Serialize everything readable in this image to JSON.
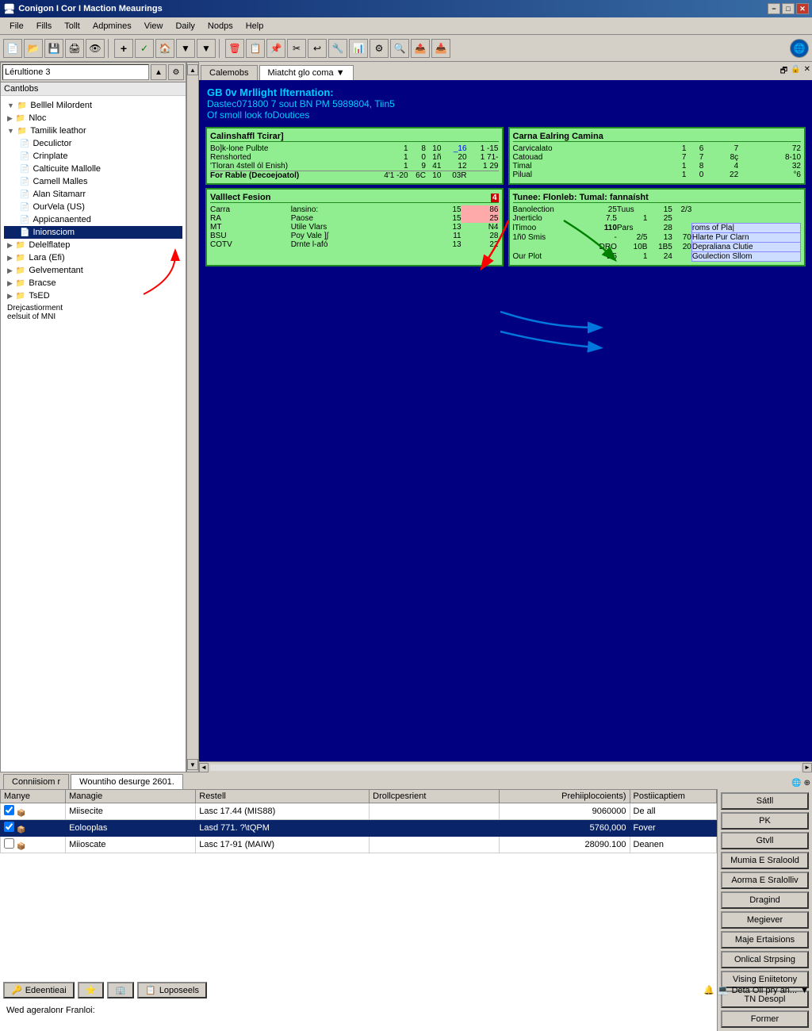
{
  "titlebar": {
    "title": "Conigon I Cor I Maction Meaurings",
    "min_btn": "−",
    "max_btn": "□",
    "close_btn": "✕"
  },
  "menubar": {
    "items": [
      "File",
      "Fills",
      "Tollt",
      "Adpmines",
      "View",
      "Daily",
      "Nodps",
      "Help"
    ]
  },
  "dropdown": {
    "value": "Lérultione 3"
  },
  "tabs": {
    "items": [
      "Calemobs",
      "Miatcht glo coma"
    ]
  },
  "left_panel": {
    "header": "Cantlobs",
    "tree": [
      {
        "label": "Belllel Milordent",
        "level": 1,
        "expanded": true
      },
      {
        "label": "Nloc",
        "level": 1
      },
      {
        "label": "Tamilik leathor",
        "level": 1,
        "expanded": true
      },
      {
        "label": "Deculictor",
        "level": 2
      },
      {
        "label": "Crinplate",
        "level": 2
      },
      {
        "label": "Calticuite Mallolle",
        "level": 2
      },
      {
        "label": "Camell Malles",
        "level": 2
      },
      {
        "label": "Alan Sitamarr",
        "level": 2
      },
      {
        "label": "OurVela (US)",
        "level": 2
      },
      {
        "label": "Appicanaented",
        "level": 2
      },
      {
        "label": "Inionsciom",
        "level": 2,
        "selected": true
      },
      {
        "label": "Delelflatep",
        "level": 1
      },
      {
        "label": "Lara (Efi)",
        "level": 1
      },
      {
        "label": "Gelvementant",
        "level": 1
      },
      {
        "label": "Bracse",
        "level": 1
      },
      {
        "label": "TsED",
        "level": 1
      }
    ]
  },
  "content": {
    "info_line1": "GB 0v Mrllight lfternation:",
    "info_line2": "Dastec071800 7 sout BN PM 5989804, Tiin5",
    "info_line3": "Of smoll look foDoutices"
  },
  "carinshaffl_panel": {
    "title": "Calinshaffl Tcirar]",
    "rows": [
      {
        "label": "Bo]k-lone Pulbte",
        "c1": 1,
        "c2": 8,
        "c3": 10,
        "c4": -16,
        "c5": "1 -15"
      },
      {
        "label": "Renshorted",
        "c1": 1,
        "c2": 0,
        "c3": "1(1",
        "c4": 20,
        "c5": "1 71"
      },
      {
        "label": "'Tloran 4stell ól Enish)",
        "c1": 1,
        "c2": 9,
        "c3": 41,
        "c4": 12,
        "c5": "1 29"
      },
      {
        "label": "For Rable (Decoejoatol)",
        "c1": "4'1 -20",
        "c2": "6C",
        "c3": 10,
        "c4": "03R",
        "c5": ""
      }
    ]
  },
  "carna_panel": {
    "title": "Carna Ealring Camina",
    "rows": [
      {
        "label": "Carvicalato",
        "c1": 1,
        "c2": 6,
        "c3": 7,
        "c4": 72
      },
      {
        "label": "Catouad",
        "c1": "7",
        "c2": 7,
        "c3": "87",
        "c4": "8-10"
      },
      {
        "label": "Timal",
        "c1": 1,
        "c2": 8,
        "c3": 4,
        "c4": 32
      },
      {
        "label": "Pilual",
        "c1": 1,
        "c2": 0,
        "c3": 22,
        "c4": "°6"
      }
    ]
  },
  "vallect_panel": {
    "title": "Valllect Fesion",
    "rows": [
      {
        "col1": "Carra",
        "col2": "lansino:",
        "col3": 15,
        "col4": 86
      },
      {
        "col1": "RA",
        "col2": "Paose",
        "col3": 15,
        "col4": 25
      },
      {
        "col1": "MT",
        "col2": "Utile Vlars",
        "col3": 13,
        "col4": "N4"
      },
      {
        "col1": "BSU",
        "col2": "Poy Vale ]∫",
        "col3": 11,
        "col4": 28
      },
      {
        "col1": "COTV",
        "col2": "Drnte l-afó",
        "col3": 13,
        "col4": 22
      }
    ]
  },
  "tunee_panel": {
    "title": "Tunee: Flonleb: Tumal: fannaísht",
    "rows": [
      {
        "label": "Banolection",
        "c1": 25,
        "c2": "Tuus",
        "c3": 15,
        "c4": "2/3"
      },
      {
        "label": "Jnerticlo",
        "c1": "7.5",
        "c2": 1,
        "c3": 25,
        "c4": ""
      },
      {
        "label": "lTimoo",
        "c1": 110,
        "c2": "Pars",
        "c3": 28,
        "c4": "",
        "c5": "roms of Pla|"
      },
      {
        "label": "1ñ0 Smis",
        "c1": "-",
        "c2": "2/5",
        "c3": 13,
        "c4": 70,
        "c5": "Hlarte Pur Clarn"
      },
      {
        "label": "",
        "c1": "DRO",
        "c2": "10B",
        "c3": "1B5",
        "c4": 20,
        "c5": "Depraliana Clutie"
      },
      {
        "label": "Our Plot",
        "c1": "D5",
        "c2": 1,
        "c3": 24,
        "c4": "",
        "c5": "Goulection Sllom"
      }
    ]
  },
  "lower_tabs": [
    "Conniisiom r",
    "Wountiho desurge 2601."
  ],
  "table": {
    "headers": [
      "Manye",
      "Managie",
      "Restell",
      "Drollcpesrient",
      "Prehiiplocoients)",
      "Postiicaptiem"
    ],
    "rows": [
      {
        "checkbox": true,
        "icon": true,
        "col1": "Miisecite",
        "col2": "Lasc 17.44 (MIS88)",
        "col3": "",
        "col4": 9060000,
        "col5": "De all",
        "selected": false
      },
      {
        "checkbox": true,
        "icon": true,
        "col1": "Eolooplas",
        "col2": "Lasd 771. ?\tQPM",
        "col3": "",
        "col4": 5760000,
        "col5": "Fover",
        "selected": true
      },
      {
        "checkbox": true,
        "icon": true,
        "col1": "Miioscate",
        "col2": "Lasc 17-91 (MAIW)",
        "col3": "",
        "col4": 28090100,
        "col5": "Deanen",
        "selected": false
      }
    ]
  },
  "sidebar_buttons": [
    "Sátll",
    "PK",
    "Gtvll",
    "Mumia E Sraloold",
    "Aorma E Sralolliv",
    "Dragind",
    "Megiever",
    "Maje Ertaisions",
    "Onlical Strpsing",
    "Vising Eniitetony",
    "TN Desopl",
    "Former"
  ],
  "status_bar": {
    "btn1": "Edeentieai",
    "btn2": "Loposeels",
    "right_text": "Deta Oll pry an..."
  },
  "bottom_status": "Wed ageralonr Franloi:"
}
